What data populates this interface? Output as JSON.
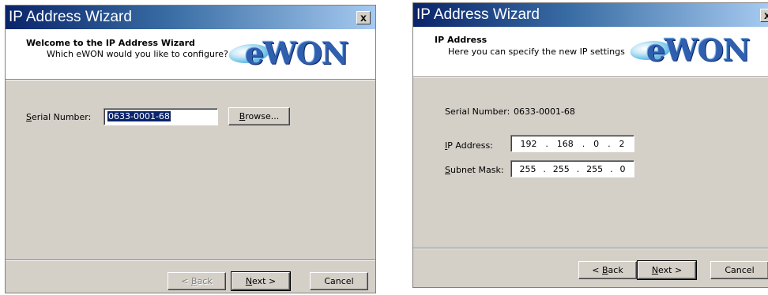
{
  "wizard1": {
    "title": "IP Address Wizard",
    "close_label": "x",
    "header": {
      "title": "Welcome to the IP Address Wizard",
      "subtitle": "Which eWON would you like to configure?"
    },
    "logo_text": "eWON",
    "serial": {
      "label_prefix": "S",
      "label_rest": "erial Number:",
      "value": "0633-0001-68"
    },
    "browse_prefix": "B",
    "browse_rest": "rowse...",
    "buttons": {
      "back_prefix": "< ",
      "back_u": "B",
      "back_rest": "ack",
      "next_u": "N",
      "next_rest": "ext >",
      "cancel": "Cancel"
    }
  },
  "wizard2": {
    "title": "IP Address Wizard",
    "close_label": "x",
    "header": {
      "title": "IP Address",
      "subtitle": "Here you can specify the new IP settings"
    },
    "logo_text": "eWON",
    "serial": {
      "label": "Serial Number:",
      "value": "0633-0001-68"
    },
    "ip": {
      "label_u": "I",
      "label_rest": "P Address:",
      "octets": [
        "192",
        "168",
        "0",
        "2"
      ]
    },
    "mask": {
      "label_u": "S",
      "label_rest": "ubnet Mask:",
      "octets": [
        "255",
        "255",
        "255",
        "0"
      ]
    },
    "buttons": {
      "back_prefix": "< ",
      "back_u": "B",
      "back_rest": "ack",
      "next_u": "N",
      "next_rest": "ext >",
      "cancel": "Cancel"
    }
  },
  "dot": "."
}
